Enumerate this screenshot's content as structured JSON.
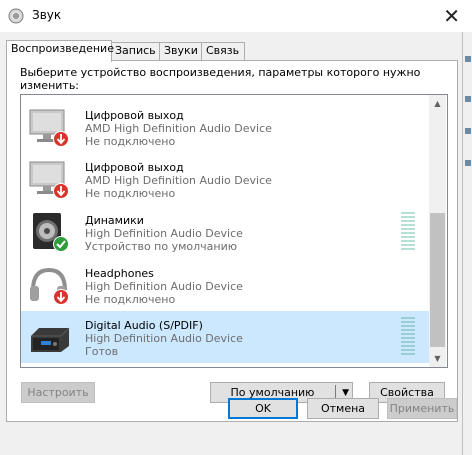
{
  "window": {
    "title": "Звук"
  },
  "tabs": [
    {
      "label": "Воспроизведение",
      "active": true
    },
    {
      "label": "Запись",
      "active": false
    },
    {
      "label": "Звуки",
      "active": false
    },
    {
      "label": "Связь",
      "active": false
    }
  ],
  "prompt": "Выберите устройство воспроизведения, параметры которого нужно изменить:",
  "devices": [
    {
      "name": "Цифровой выход",
      "driver": "AMD High Definition Audio Device",
      "status": "Не подключено",
      "icon": "monitor-icon",
      "badge": "disconnected"
    },
    {
      "name": "Цифровой выход",
      "driver": "AMD High Definition Audio Device",
      "status": "Не подключено",
      "icon": "monitor-icon",
      "badge": "disconnected"
    },
    {
      "name": "Динамики",
      "driver": "High Definition Audio Device",
      "status": "Устройство по умолчанию",
      "icon": "speaker-icon",
      "badge": "default"
    },
    {
      "name": "Headphones",
      "driver": "High Definition Audio Device",
      "status": "Не подключено",
      "icon": "headphones-icon",
      "badge": "disconnected"
    },
    {
      "name": "Digital Audio (S/PDIF)",
      "driver": "High Definition Audio Device",
      "status": "Готов",
      "icon": "spdif-receiver-icon",
      "badge": "none",
      "selected": true
    }
  ],
  "buttons": {
    "configure": "Настроить",
    "set_default": "По умолчанию",
    "properties": "Свойства",
    "ok": "OK",
    "cancel": "Отмена",
    "apply": "Применить"
  },
  "colors": {
    "selection": "#cce8ff",
    "accent": "#0078d7",
    "error_badge": "#d9342b",
    "default_badge": "#2e9e3c"
  }
}
